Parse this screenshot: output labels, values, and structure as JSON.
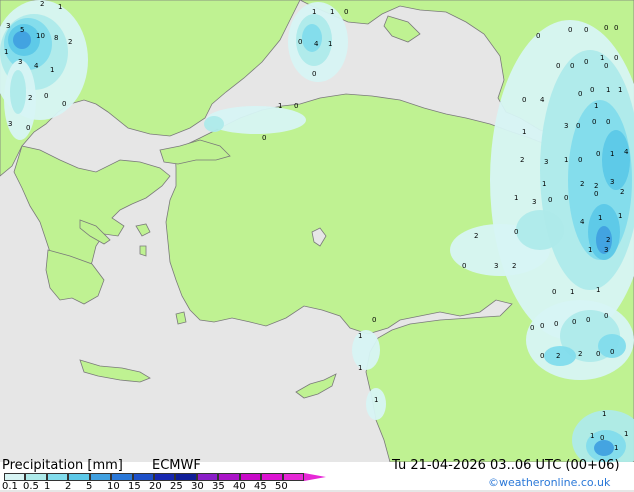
{
  "product": {
    "title": "Precipitation [mm]",
    "model": "ECMWF",
    "datetime": "Tu 21-04-2026 03..06 UTC (00+06)",
    "credit": "©weatheronline.co.uk"
  },
  "legend": {
    "ticks": [
      "0.1",
      "0.5",
      "1",
      "2",
      "5",
      "10",
      "15",
      "20",
      "25",
      "30",
      "35",
      "40",
      "45",
      "50"
    ],
    "colors": [
      "#d7f4f4",
      "#aeeaea",
      "#82dcec",
      "#5cc8e8",
      "#40a0e0",
      "#2a78d8",
      "#1e50c8",
      "#1828b0",
      "#101e98",
      "#8a1ec8",
      "#aa14c8",
      "#c80ac8",
      "#dc14d2",
      "#e628d6"
    ]
  },
  "colors": {
    "sea": "#e6e6e6",
    "land": "#bff292",
    "coast": "#7a7a7a"
  },
  "map_labels": [
    "2",
    "1",
    "3",
    "5",
    "10",
    "8",
    "2",
    "1",
    "3",
    "4",
    "1",
    "2",
    "0",
    "0",
    "3",
    "0",
    "1",
    "1",
    "0",
    "0",
    "4",
    "1",
    "0",
    "1",
    "0",
    "0",
    "0",
    "0",
    "0",
    "0",
    "0",
    "1",
    "0",
    "0",
    "0",
    "0",
    "0",
    "0",
    "0",
    "1",
    "1",
    "0",
    "4",
    "1",
    "3",
    "0",
    "0",
    "0",
    "1",
    "2",
    "3",
    "1",
    "0",
    "0",
    "1",
    "4",
    "1",
    "2",
    "2",
    "3",
    "1",
    "0",
    "0",
    "2",
    "3",
    "0",
    "1",
    "1",
    "4",
    "2",
    "1",
    "3",
    "2",
    "0",
    "3",
    "2",
    "0",
    "0",
    "1",
    "1",
    "0",
    "0",
    "0",
    "0",
    "0",
    "0",
    "0",
    "0",
    "2",
    "2",
    "0",
    "0",
    "1",
    "1",
    "1",
    "1",
    "1",
    "0",
    "1",
    "1",
    "5",
    "1",
    "0"
  ]
}
